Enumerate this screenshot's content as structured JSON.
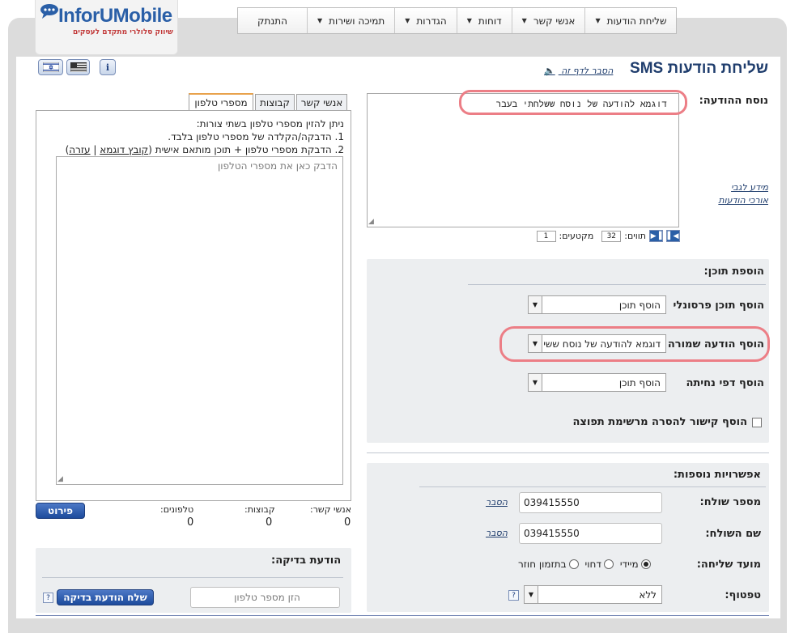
{
  "brand": {
    "logo_text": "InforUMobile",
    "tagline": "שיווק סלולרי מתקדם לעסקים"
  },
  "topnav": {
    "items": [
      {
        "label": "שליחת הודעות",
        "has_dropdown": true
      },
      {
        "label": "אנשי קשר",
        "has_dropdown": true
      },
      {
        "label": "דוחות",
        "has_dropdown": true
      },
      {
        "label": "הגדרות",
        "has_dropdown": true
      },
      {
        "label": "תמיכה ושירות",
        "has_dropdown": true
      },
      {
        "label": "התנתק",
        "has_dropdown": false
      }
    ]
  },
  "header": {
    "title": "שליחת הודעות SMS",
    "explain_link": "הסבר לדף זה"
  },
  "message": {
    "label": "נוסח ההודעה:",
    "text": "דוגמא להודעה של נוסח ששלחתי בעבר",
    "legal_link": "מידע לגבי",
    "length_link": "אורכי הודעות",
    "chars_label": "תווים:",
    "chars_value": "32",
    "segments_label": "מקטעים:",
    "segments_value": "1"
  },
  "add_content": {
    "title": "הוספת תוכן:",
    "personal_label": "הוסף תוכן פרסונלי",
    "personal_value": "הוסף תוכן",
    "saved_label": "הוסף הודעה שמורה",
    "saved_value": "דוגמא להודעה של נוסח ששי",
    "landing_label": "הוסף דפי נחיתה",
    "landing_value": "הוסף תוכן",
    "unsubscribe_label": "הוסף קישור להסרה מרשימת תפוצה"
  },
  "more_options": {
    "title": "אפשרויות נוספות:",
    "sender_number_label": "מספר שולח:",
    "sender_number_value": "039415550",
    "sender_name_label": "שם השולח:",
    "sender_name_value": "039415550",
    "explain_link": "הסבר",
    "send_time_label": "מועד שליחה:",
    "send_time_options": [
      "מיידי",
      "דחוי",
      "בתזמון חוזר"
    ],
    "send_time_selected": "מיידי",
    "template_label": "טפטוף:",
    "template_value": "ללא"
  },
  "recipients": {
    "tabs": [
      "אנשי קשר",
      "קבוצות",
      "מספרי טלפון"
    ],
    "active_tab": "מספרי טלפון",
    "intro": "ניתן להזין מספרי טלפון בשתי צורות:",
    "line1": "1. הדבקה/הקלדה של מספרי טלפון בלבד.",
    "line2": "2. הדבקת מספרי טלפון + תוכן מותאם אישית",
    "sample_link": "קובץ דוגמא",
    "help_link": "עזרה",
    "placeholder": "הדבק כאן את מספרי הטלפון",
    "count_contacts_label": "אנשי קשר:",
    "count_contacts": "0",
    "count_groups_label": "קבוצות:",
    "count_groups": "0",
    "count_phones_label": "טלפונים:",
    "count_phones": "0",
    "details_button": "פירוט"
  },
  "test_message": {
    "title": "הודעת בדיקה:",
    "phone_placeholder": "הזן מספר טלפון",
    "send_button": "שלח הודעת בדיקה"
  },
  "toolbar": {
    "info_icon": "i"
  },
  "colors": {
    "accent": "#1f3d6d",
    "highlight": "#ec7e86",
    "button": "#1d4b9c"
  }
}
